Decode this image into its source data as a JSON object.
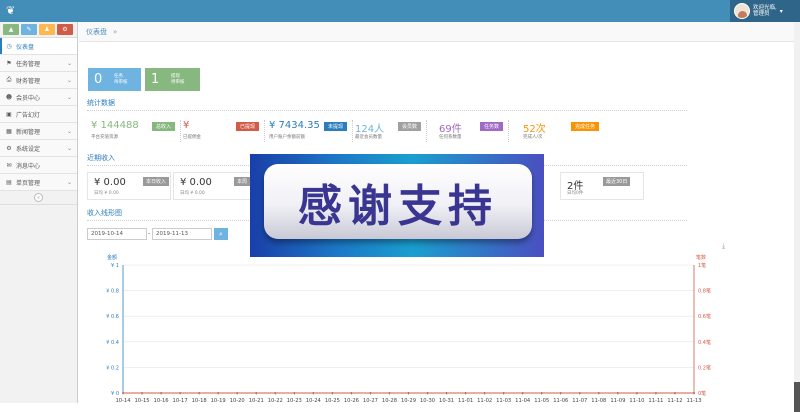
{
  "user": {
    "greeting": "欢迎光临,",
    "name": "管理员"
  },
  "sidebar": {
    "items": [
      {
        "label": "仪表盘",
        "icon": "dashboard-icon",
        "active": true,
        "expandable": false
      },
      {
        "label": "任务管理",
        "icon": "flag-icon",
        "expandable": true
      },
      {
        "label": "财务管理",
        "icon": "print-icon",
        "expandable": true
      },
      {
        "label": "会员中心",
        "icon": "user-icon",
        "expandable": true
      },
      {
        "label": "广告幻灯",
        "icon": "image-icon",
        "expandable": false
      },
      {
        "label": "新闻管理",
        "icon": "grid-icon",
        "expandable": true
      },
      {
        "label": "系统设定",
        "icon": "gear-icon",
        "expandable": true
      },
      {
        "label": "消息中心",
        "icon": "comment-icon",
        "expandable": false
      },
      {
        "label": "单页管理",
        "icon": "book-icon",
        "expandable": true
      }
    ]
  },
  "breadcrumb": {
    "current": "仪表盘",
    "sep": "»"
  },
  "tiles": [
    {
      "num": "0",
      "line1": "任务",
      "line2": "待审核"
    },
    {
      "num": "1",
      "line1": "提现",
      "line2": "待审核"
    }
  ],
  "sections": {
    "stats": "统计数据",
    "recent": "近期收入",
    "line": "收入线形图"
  },
  "stats": [
    {
      "value": "¥ 144488",
      "sub": "平台充值资源",
      "badge": "总收入",
      "color": "#87b87f",
      "badge_color": "#87b87f"
    },
    {
      "value": "¥",
      "sub": "已提佣金",
      "badge": "已提现",
      "color": "#d15b47",
      "badge_color": "#d15b47"
    },
    {
      "value": "¥ 7434.35",
      "sub": "用户账户余额前额",
      "badge": "未提现",
      "color": "#2b7dbc",
      "badge_color": "#2b7dbc"
    },
    {
      "value": "124人",
      "sub": "最近会员数量",
      "badge": "会员数",
      "color": "#6fb3e0",
      "badge_color": "#a0a0a0"
    },
    {
      "value": "69件",
      "sub": "任何系数量",
      "badge": "任务数",
      "color": "#a069c3",
      "badge_color": "#a069c3"
    },
    {
      "value": "52次",
      "sub": "完成人/次",
      "badge": "完成任务",
      "color": "#f89406",
      "badge_color": "#f89406"
    }
  ],
  "income": [
    {
      "value": "¥ 0.00",
      "sub": "日均 ¥ 0.00",
      "badge": "本日收入"
    },
    {
      "value": "¥ 0.00",
      "sub": "日均 ¥ 0.00",
      "badge": "本周"
    },
    {
      "value": "2件",
      "sub": "日均0件",
      "badge": "最近30日"
    }
  ],
  "dates": {
    "start": "2019-10-14",
    "mid": "-",
    "end": "2019-11-13"
  },
  "overlay": {
    "text": "感谢支持"
  },
  "chart_data": {
    "type": "line",
    "title": "",
    "x": [
      "10-14",
      "10-15",
      "10-16",
      "10-17",
      "10-18",
      "10-19",
      "10-20",
      "10-21",
      "10-22",
      "10-23",
      "10-24",
      "10-25",
      "10-26",
      "10-27",
      "10-28",
      "10-29",
      "10-30",
      "10-31",
      "11-01",
      "11-02",
      "11-03",
      "11-04",
      "11-05",
      "11-06",
      "11-07",
      "11-08",
      "11-09",
      "11-10",
      "11-11",
      "11-12",
      "11-13"
    ],
    "left_axis": {
      "label": "金额",
      "ticks": [
        "¥ 1",
        "¥ 0.8",
        "¥ 0.6",
        "¥ 0.4",
        "¥ 0.2",
        "¥ 0"
      ],
      "color": "#2b7dbc"
    },
    "right_axis": {
      "label": "笔数",
      "ticks": [
        "1笔",
        "0.8笔",
        "0.6笔",
        "0.4笔",
        "0.2笔",
        "0笔"
      ],
      "color": "#d15b47"
    },
    "ylim": [
      0,
      1
    ],
    "series": [
      {
        "values": [
          0,
          0,
          0,
          0,
          0,
          0,
          0,
          0,
          0,
          0,
          0,
          0,
          0,
          0,
          0,
          0,
          0,
          0,
          0,
          0,
          0,
          0,
          0,
          0,
          0,
          0,
          0,
          0,
          0,
          0,
          0
        ],
        "color": "#2b7dbc"
      },
      {
        "values": [
          0,
          0,
          0,
          0,
          0,
          0,
          0,
          0,
          0,
          0,
          0,
          0,
          0,
          0,
          0,
          0,
          0,
          0,
          0,
          0,
          0,
          0,
          0,
          0,
          0,
          0,
          0,
          0,
          0,
          0,
          0
        ],
        "color": "#d15b47"
      }
    ],
    "grid": true
  }
}
